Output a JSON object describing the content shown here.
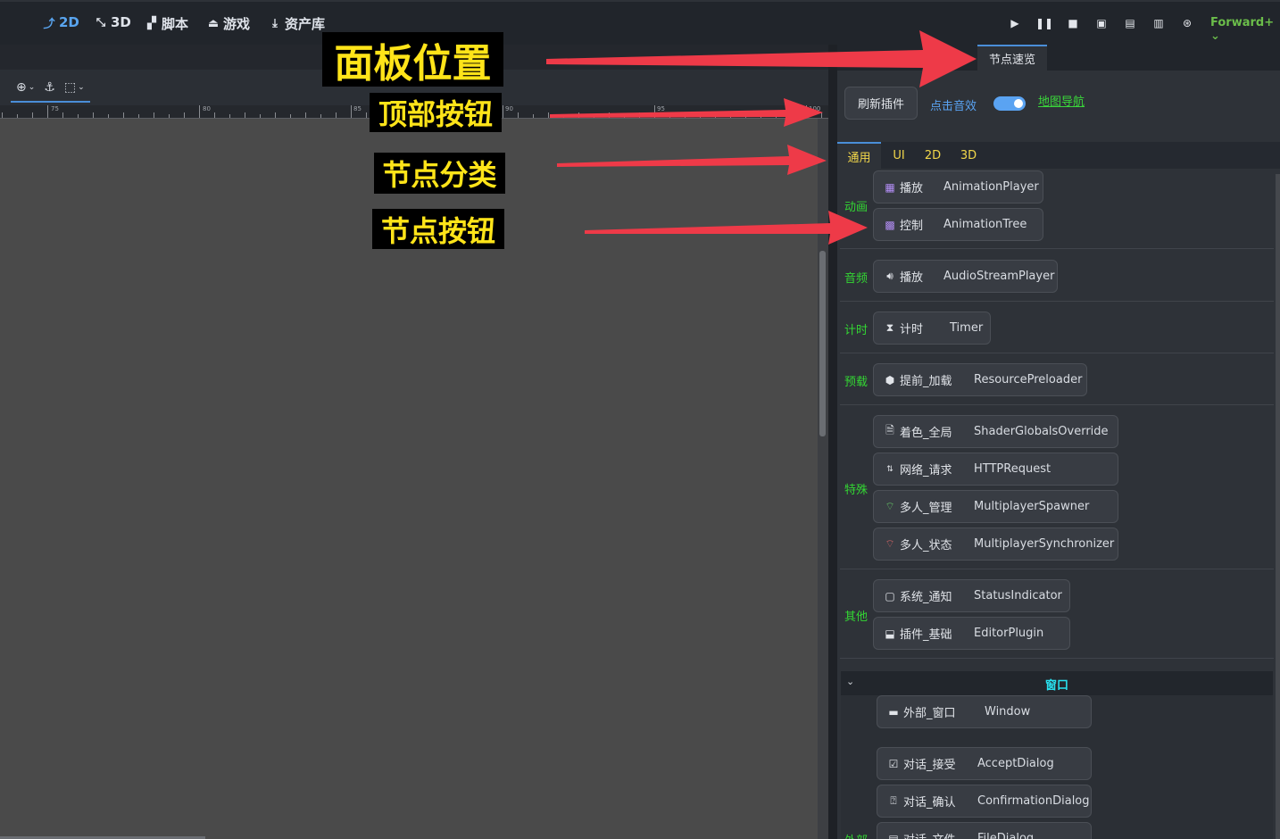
{
  "topbar": {
    "modes": [
      {
        "label": "2D",
        "icon": "2d-icon"
      },
      {
        "label": "3D",
        "icon": "3d-icon"
      },
      {
        "label": "脚本",
        "icon": "script-icon"
      },
      {
        "label": "游戏",
        "icon": "game-icon"
      },
      {
        "label": "资产库",
        "icon": "asset-library-icon"
      }
    ],
    "active_mode": "2D",
    "run_icons": [
      "play-icon",
      "pause-icon",
      "stop-icon",
      "remote-debug-icon",
      "play-scene-icon",
      "play-custom-scene-icon",
      "movie-maker-icon"
    ],
    "renderer": "Forward+"
  },
  "viewport": {
    "toolbar_icons": [
      "add-node-icon",
      "anchor-icon",
      "grid-snap-icon"
    ],
    "ruler": {
      "labels": [
        "75",
        "80",
        "85",
        "90",
        "95",
        "100"
      ]
    },
    "canvas_color": "#4a4a4a"
  },
  "panel": {
    "tab_label": "节点速览",
    "refresh_label": "刷新插件",
    "click_sound_label": "点击音效",
    "click_sound_on": true,
    "map_nav_label": "地图导航",
    "categories": [
      {
        "label": "通用",
        "active": true
      },
      {
        "label": "UI",
        "active": false
      },
      {
        "label": "2D",
        "active": false
      },
      {
        "label": "3D",
        "active": false
      }
    ],
    "groups": [
      {
        "label": "动画",
        "nodes": [
          {
            "cn": "播放",
            "en": "AnimationPlayer",
            "icon": "animation-player-icon"
          },
          {
            "cn": "控制",
            "en": "AnimationTree",
            "icon": "animation-tree-icon"
          }
        ]
      },
      {
        "label": "音频",
        "nodes": [
          {
            "cn": "播放",
            "en": "AudioStreamPlayer",
            "icon": "speaker-icon"
          }
        ]
      },
      {
        "label": "计时",
        "nodes": [
          {
            "cn": "计时",
            "en": "Timer",
            "icon": "hourglass-icon"
          }
        ]
      },
      {
        "label": "预载",
        "nodes": [
          {
            "cn": "提前_加载",
            "en": "ResourcePreloader",
            "icon": "cube-icon"
          }
        ]
      },
      {
        "label": "特殊",
        "nodes": [
          {
            "cn": "着色_全局",
            "en": "ShaderGlobalsOverride",
            "icon": "shader-icon"
          },
          {
            "cn": "网络_请求",
            "en": "HTTPRequest",
            "icon": "http-icon"
          },
          {
            "cn": "多人_管理",
            "en": "MultiplayerSpawner",
            "icon": "wifi-icon"
          },
          {
            "cn": "多人_状态",
            "en": "MultiplayerSynchronizer",
            "icon": "wifi-sync-icon"
          }
        ]
      },
      {
        "label": "其他",
        "nodes": [
          {
            "cn": "系统_通知",
            "en": "StatusIndicator",
            "icon": "status-icon"
          },
          {
            "cn": "插件_基础",
            "en": "EditorPlugin",
            "icon": "plugin-icon"
          }
        ]
      }
    ],
    "window_section": {
      "title": "窗口",
      "group_label": "外部",
      "nodes": [
        {
          "cn": "外部_窗口",
          "en": "Window",
          "icon": "window-icon"
        },
        {
          "cn": "对话_接受",
          "en": "AcceptDialog",
          "icon": "accept-dialog-icon"
        },
        {
          "cn": "对话_确认",
          "en": "ConfirmationDialog",
          "icon": "confirm-dialog-icon"
        },
        {
          "cn": "对话_文件",
          "en": "FileDialog",
          "icon": "file-dialog-icon"
        }
      ]
    }
  },
  "annotations": [
    {
      "text": "面板位置"
    },
    {
      "text": "顶部按钮"
    },
    {
      "text": "节点分类"
    },
    {
      "text": "节点按钮"
    }
  ],
  "colors": {
    "accent": "#4a8ed8",
    "group_label": "#33d633",
    "category_label": "#f2d74a",
    "annotation_text": "#ffe419",
    "arrow": "#ee3a48"
  }
}
